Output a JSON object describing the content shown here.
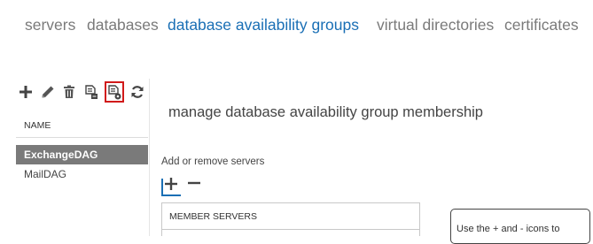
{
  "nav": {
    "tabs": [
      {
        "label": "servers"
      },
      {
        "label": "databases"
      },
      {
        "label": "database availability groups",
        "active": true
      },
      {
        "label": "virtual directories"
      },
      {
        "label": "certificates"
      }
    ]
  },
  "toolbar": {
    "buttons": [
      {
        "icon": "plus-icon"
      },
      {
        "icon": "pencil-icon"
      },
      {
        "icon": "trash-icon"
      },
      {
        "icon": "document-properties-icon"
      },
      {
        "icon": "manage-membership-icon",
        "selected": true
      },
      {
        "icon": "refresh-icon"
      }
    ]
  },
  "list": {
    "column_header": "NAME",
    "items": [
      {
        "label": "ExchangeDAG",
        "selected": true
      },
      {
        "label": "MailDAG",
        "selected": false
      }
    ]
  },
  "panel": {
    "title": "manage database availability group membership",
    "add_remove_label": "Add or remove servers",
    "add_icon": "plus-icon",
    "remove_icon": "minus-icon",
    "members_header": "MEMBER SERVERS",
    "tooltip": "Use the + and - icons to"
  },
  "colors": {
    "accent": "#1a6fb5",
    "highlight_outline": "#d11a1a",
    "selected_row": "#7a7a7a"
  }
}
